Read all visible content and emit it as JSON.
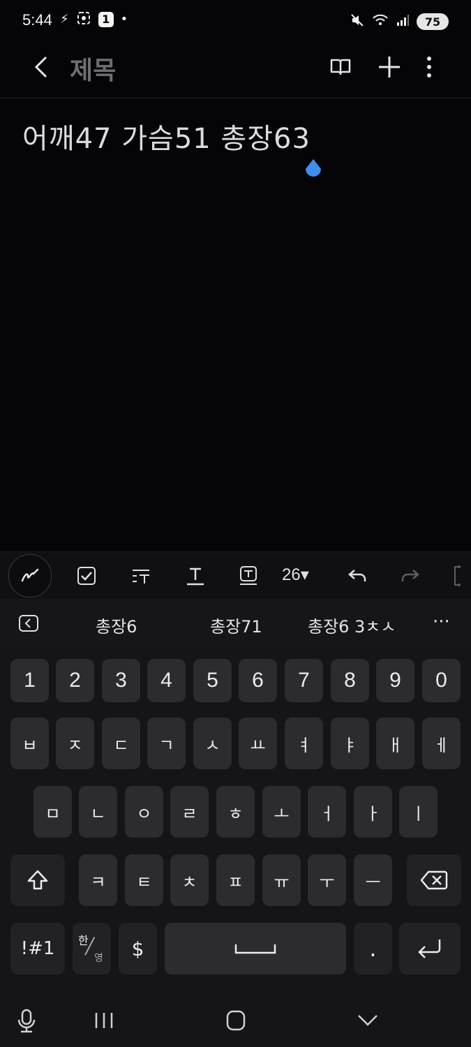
{
  "status_bar": {
    "time": "5:44",
    "notification_badge": "1",
    "battery": "75"
  },
  "app_bar": {
    "title": "제목"
  },
  "note": {
    "text": "어깨47 가슴51 총장63"
  },
  "format_toolbar": {
    "font_size": "26▾"
  },
  "suggestions": {
    "items": [
      "총장6",
      "총장71",
      "총장6 3ㅊㅅ"
    ],
    "more": "···"
  },
  "keyboard": {
    "row_numbers": [
      "1",
      "2",
      "3",
      "4",
      "5",
      "6",
      "7",
      "8",
      "9",
      "0"
    ],
    "row1": [
      "ㅂ",
      "ㅈ",
      "ㄷ",
      "ㄱ",
      "ㅅ",
      "ㅛ",
      "ㅕ",
      "ㅑ",
      "ㅐ",
      "ㅔ"
    ],
    "row2": [
      "ㅁ",
      "ㄴ",
      "ㅇ",
      "ㄹ",
      "ㅎ",
      "ㅗ",
      "ㅓ",
      "ㅏ",
      "ㅣ"
    ],
    "row3": [
      "ㅋ",
      "ㅌ",
      "ㅊ",
      "ㅍ",
      "ㅠ",
      "ㅜ",
      "ㅡ"
    ],
    "symbols_label": "!#1",
    "lang_top": "한",
    "lang_bottom": "영",
    "dollar": "$",
    "period": "."
  },
  "colors": {
    "background": "#050507",
    "key": "#2c2c2f",
    "cursor": "#3f8ff0"
  }
}
